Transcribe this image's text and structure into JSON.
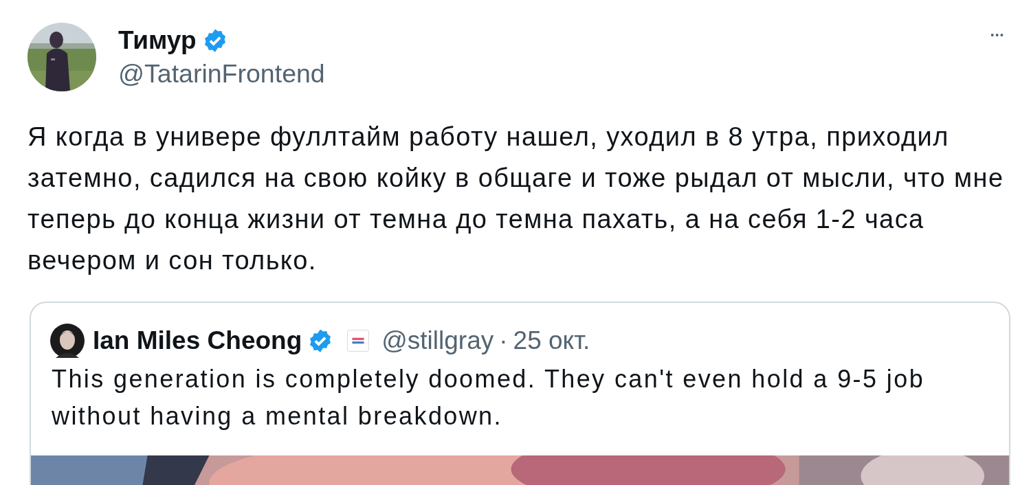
{
  "post": {
    "author": {
      "name": "Тимур",
      "handle": "@TatarinFrontend",
      "verified": true
    },
    "more": "•••",
    "text": "Я когда в универе фуллтайм работу нашел, уходил в 8 утра, приходил затемно, садился на свою койку в общаге и тоже рыдал от мысли, что мне теперь до конца жизни от темна до темна пахать, а на себя 1-2 часа вечером и сон только.",
    "quote": {
      "author": {
        "name": "Ian Miles Cheong",
        "verified": true,
        "affiliate_badge": true,
        "handle": "@stillgray",
        "separator": "·",
        "date": "25 окт."
      },
      "text": "This generation is completely doomed. They can't even hold a 9-5 job without having a mental breakdown."
    }
  }
}
